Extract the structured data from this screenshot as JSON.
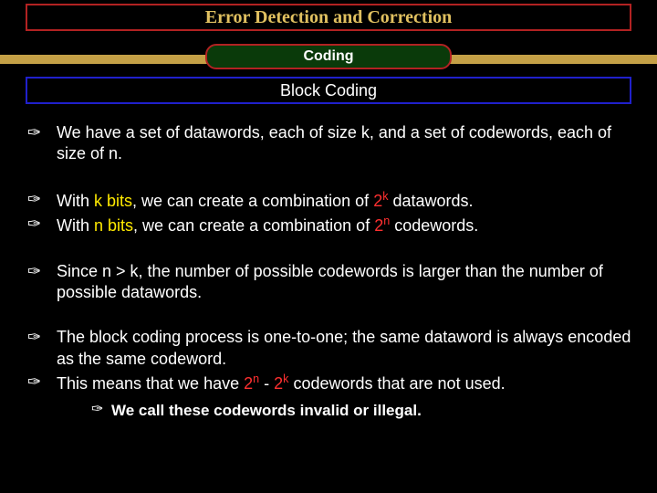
{
  "title": "Error Detection and Correction",
  "badge": "Coding",
  "subtitle": "Block Coding",
  "bullets": {
    "b1": {
      "t1": "We have a set of datawords, each of size k, and a set of codewords, each of size of n."
    },
    "b2": {
      "a_pre": "With ",
      "a_hl1": "k bits",
      "a_mid": ", we can create a combination of ",
      "a_base": "2",
      "a_sup": "k",
      "a_post": " datawords.",
      "b_pre": "With ",
      "b_hl1": "n bits",
      "b_mid": ", we can create a combination of ",
      "b_base": "2",
      "b_sup": "n",
      "b_post": " codewords."
    },
    "b3": {
      "t1": "Since n > k, the number of possible codewords is larger than the number of possible datawords."
    },
    "b4": {
      "a": "The block coding process is one-to-one; the same dataword is always encoded as the same codeword.",
      "b_pre": "This means that we have ",
      "b_base1": "2",
      "b_sup1": "n",
      "b_mid": " - ",
      "b_base2": "2",
      "b_sup2": "k",
      "b_post": " codewords that are not used.",
      "sub": "We call these codewords invalid or illegal."
    }
  }
}
